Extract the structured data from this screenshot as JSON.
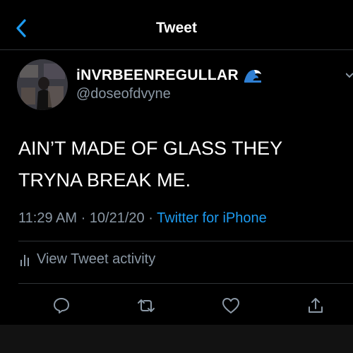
{
  "header": {
    "title": "Tweet"
  },
  "user": {
    "display_name": "iNVRBEENREGULLAR",
    "handle": "@doseofdvyne"
  },
  "tweet": {
    "text_line1": "AIN’T MADE OF GLASS THEY",
    "text_line2": "TRYNA BREAK ME.",
    "time": "11:29 AM",
    "date": "10/21/20",
    "source": "Twitter for iPhone"
  },
  "activity": {
    "label": "View Tweet activity"
  },
  "icons": {
    "back": "chevron-left-icon",
    "badge": "wave-icon",
    "reply": "reply-icon",
    "retweet": "retweet-icon",
    "like": "heart-icon",
    "share": "share-icon",
    "activity": "bar-chart-icon"
  },
  "colors": {
    "accent": "#1d9bf0",
    "background": "#000000",
    "secondary_text": "#8b98a5"
  }
}
